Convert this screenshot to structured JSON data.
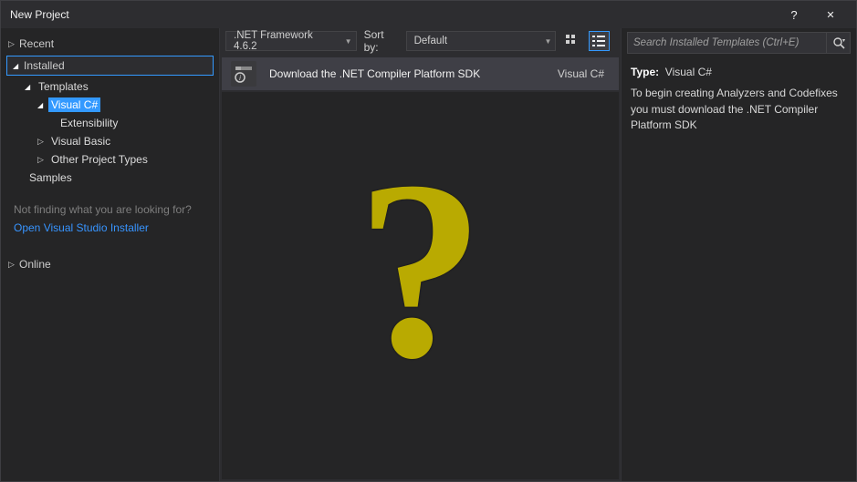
{
  "window": {
    "title": "New Project"
  },
  "nav": {
    "recent": "Recent",
    "installed": "Installed",
    "templates": "Templates",
    "visual_csharp": "Visual C#",
    "extensibility": "Extensibility",
    "visual_basic": "Visual Basic",
    "other_project_types": "Other Project Types",
    "samples": "Samples",
    "online": "Online"
  },
  "left_footer": {
    "hint": "Not finding what you are looking for?",
    "link": "Open Visual Studio Installer"
  },
  "toolbar": {
    "framework": ".NET Framework 4.6.2",
    "sort_label": "Sort by:",
    "sort_value": "Default"
  },
  "template": {
    "name": "Download the .NET Compiler Platform SDK",
    "lang": "Visual C#"
  },
  "details": {
    "type_label": "Type:",
    "type_value": "Visual C#",
    "desc": "To begin creating Analyzers and Codefixes you must download the .NET Compiler Platform SDK"
  },
  "search": {
    "placeholder": "Search Installed Templates (Ctrl+E)"
  }
}
